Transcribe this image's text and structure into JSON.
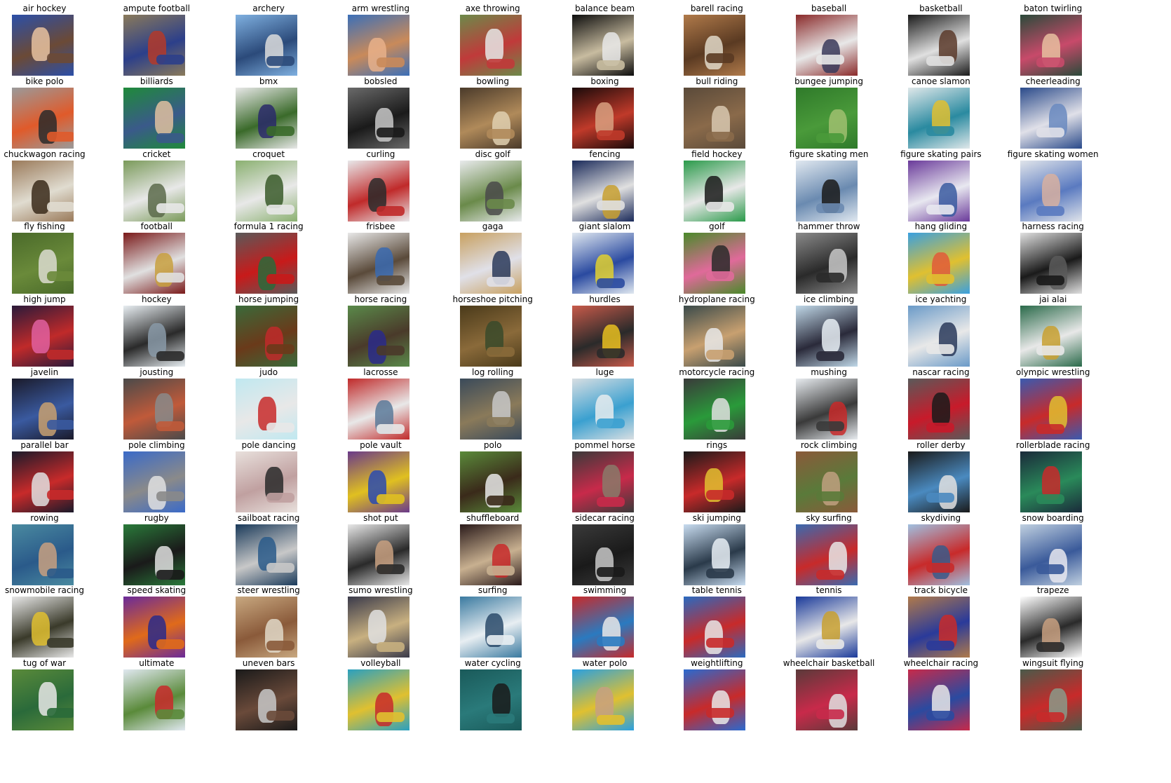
{
  "figure": {
    "rows": 11,
    "cols": 10,
    "tiles": [
      {
        "label": "air hockey",
        "colors": [
          "#2b4fa8",
          "#6b4a36",
          "#e8c2a0"
        ]
      },
      {
        "label": "ampute football",
        "colors": [
          "#8a7a5a",
          "#2c3f8a",
          "#b33a2a"
        ]
      },
      {
        "label": "archery",
        "colors": [
          "#7fb0e0",
          "#2b4a7a",
          "#dcdcdc"
        ]
      },
      {
        "label": "arm wrestling",
        "colors": [
          "#3b6fb8",
          "#c98a5a",
          "#e8b08a"
        ]
      },
      {
        "label": "axe throwing",
        "colors": [
          "#6c8a4a",
          "#c03a3a",
          "#e6e6e6"
        ]
      },
      {
        "label": "balance beam",
        "colors": [
          "#0d0d0d",
          "#c8bca0",
          "#e8e8e8"
        ]
      },
      {
        "label": "barell racing",
        "colors": [
          "#b07a4a",
          "#5a3a22",
          "#e0d8c8"
        ]
      },
      {
        "label": "baseball",
        "colors": [
          "#8a2a2a",
          "#e8e8e8",
          "#3a3a5a"
        ]
      },
      {
        "label": "basketball",
        "colors": [
          "#1a1a1a",
          "#e0e0e0",
          "#5a3a2a"
        ]
      },
      {
        "label": "baton twirling",
        "colors": [
          "#2a4a3a",
          "#c84a6a",
          "#e8c0a0"
        ]
      },
      {
        "label": "bike polo",
        "colors": [
          "#9a9a9a",
          "#e05a2a",
          "#2a2a2a"
        ]
      },
      {
        "label": "billiards",
        "colors": [
          "#1f8a3a",
          "#3a5a8a",
          "#e0c0a0"
        ]
      },
      {
        "label": "bmx",
        "colors": [
          "#e8e8e8",
          "#3a6a2a",
          "#2a2a6a"
        ]
      },
      {
        "label": "bobsled",
        "colors": [
          "#6a6a6a",
          "#1a1a1a",
          "#c8c8c8"
        ]
      },
      {
        "label": "bowling",
        "colors": [
          "#4a3a2a",
          "#b08a5a",
          "#e0d0b0"
        ]
      },
      {
        "label": "boxing",
        "colors": [
          "#1a0a0a",
          "#c03a2a",
          "#d8a080"
        ]
      },
      {
        "label": "bull riding",
        "colors": [
          "#5a4a3a",
          "#8a6a4a",
          "#d8c8b0"
        ]
      },
      {
        "label": "bungee jumping",
        "colors": [
          "#2f7a2a",
          "#4a9a3a",
          "#a0c070"
        ]
      },
      {
        "label": "canoe slamon",
        "colors": [
          "#e0e8ea",
          "#2a8aa0",
          "#e0c030"
        ]
      },
      {
        "label": "cheerleading",
        "colors": [
          "#2a4a8a",
          "#e0e0e8",
          "#6a8ac0"
        ]
      },
      {
        "label": "chuckwagon racing",
        "colors": [
          "#9a7a5a",
          "#e0dcd0",
          "#3a2a1a"
        ]
      },
      {
        "label": "cricket",
        "colors": [
          "#7a9a5a",
          "#e8e8e8",
          "#5a6a4a"
        ]
      },
      {
        "label": "croquet",
        "colors": [
          "#8ab070",
          "#e8e8e8",
          "#3a5a2a"
        ]
      },
      {
        "label": "curling",
        "colors": [
          "#e8e8ea",
          "#c02a2a",
          "#2a2a2a"
        ]
      },
      {
        "label": "disc golf",
        "colors": [
          "#e8eaec",
          "#6a8a4a",
          "#4a4a4a"
        ]
      },
      {
        "label": "fencing",
        "colors": [
          "#1a2a5a",
          "#e0e0e0",
          "#c8a030"
        ]
      },
      {
        "label": "field hockey",
        "colors": [
          "#2a9a4a",
          "#e8e8e8",
          "#1a1a1a"
        ]
      },
      {
        "label": "figure skating men",
        "colors": [
          "#e0e8f0",
          "#6a8ab0",
          "#1a1a1a"
        ]
      },
      {
        "label": "figure skating pairs",
        "colors": [
          "#6a3a9a",
          "#e8e8f0",
          "#3a5aa0"
        ]
      },
      {
        "label": "figure skating women",
        "colors": [
          "#e0e4ea",
          "#5a7ac0",
          "#d8b0a0"
        ]
      },
      {
        "label": "fly fishing",
        "colors": [
          "#4a6a2a",
          "#6a8a3a",
          "#dcdcd0"
        ]
      },
      {
        "label": "football",
        "colors": [
          "#7a1a1a",
          "#e0e0e0",
          "#c8a040"
        ]
      },
      {
        "label": "formula 1 racing",
        "colors": [
          "#5a5a5a",
          "#c81a1a",
          "#2a6a3a"
        ]
      },
      {
        "label": "frisbee",
        "colors": [
          "#e8e8e8",
          "#5a4a3a",
          "#3a6ab0"
        ]
      },
      {
        "label": "gaga",
        "colors": [
          "#c8a060",
          "#e0e0e8",
          "#2a3a5a"
        ]
      },
      {
        "label": "giant slalom",
        "colors": [
          "#e0e8f0",
          "#2a4aa0",
          "#e0d030"
        ]
      },
      {
        "label": "golf",
        "colors": [
          "#4a8a2a",
          "#e06a9a",
          "#2a2a2a"
        ]
      },
      {
        "label": "hammer throw",
        "colors": [
          "#8a8a8a",
          "#2a2a2a",
          "#c8c8c8"
        ]
      },
      {
        "label": "hang gliding",
        "colors": [
          "#3aa0e0",
          "#e0c030",
          "#e05a3a"
        ]
      },
      {
        "label": "harness racing",
        "colors": [
          "#e0e0e0",
          "#1a1a1a",
          "#5a5a5a"
        ]
      },
      {
        "label": "high jump",
        "colors": [
          "#2a1a3a",
          "#c02a2a",
          "#e060a0"
        ]
      },
      {
        "label": "hockey",
        "colors": [
          "#e8eef2",
          "#2a2a2a",
          "#8a9aa8"
        ]
      },
      {
        "label": "horse jumping",
        "colors": [
          "#3a6a3a",
          "#6a3a1a",
          "#c02a2a"
        ]
      },
      {
        "label": "horse racing",
        "colors": [
          "#5a8a4a",
          "#4a3a2a",
          "#2a2a8a"
        ]
      },
      {
        "label": "horseshoe pitching",
        "colors": [
          "#4a3a1a",
          "#8a6a3a",
          "#3a4a2a"
        ]
      },
      {
        "label": "hurdles",
        "colors": [
          "#c85a4a",
          "#2a2a2a",
          "#e8c020"
        ]
      },
      {
        "label": "hydroplane racing",
        "colors": [
          "#3a4a4a",
          "#c8a070",
          "#e8e8e8"
        ]
      },
      {
        "label": "ice climbing",
        "colors": [
          "#c0d8e8",
          "#2a2a3a",
          "#e8eef4"
        ]
      },
      {
        "label": "ice yachting",
        "colors": [
          "#6a9ac8",
          "#e8e8e8",
          "#2a3a5a"
        ]
      },
      {
        "label": "jai alai",
        "colors": [
          "#2a6a4a",
          "#e8e8e8",
          "#c8a030"
        ]
      },
      {
        "label": "javelin",
        "colors": [
          "#1a1a2a",
          "#3a5aa0",
          "#c8a070"
        ]
      },
      {
        "label": "jousting",
        "colors": [
          "#4a4a4a",
          "#c05a3a",
          "#8a8a8a"
        ]
      },
      {
        "label": "judo",
        "colors": [
          "#c0e8f0",
          "#e8e8e8",
          "#c82a2a"
        ]
      },
      {
        "label": "lacrosse",
        "colors": [
          "#c02a2a",
          "#e8e8e8",
          "#5a7a9a"
        ]
      },
      {
        "label": "log rolling",
        "colors": [
          "#3a4a5a",
          "#8a7a5a",
          "#c8c8c8"
        ]
      },
      {
        "label": "luge",
        "colors": [
          "#d8dee2",
          "#3aa0d0",
          "#e8ecee"
        ]
      },
      {
        "label": "motorcycle racing",
        "colors": [
          "#3a3a3a",
          "#2a9a3a",
          "#e0e0e0"
        ]
      },
      {
        "label": "mushing",
        "colors": [
          "#e8ecf0",
          "#3a3a3a",
          "#c82a2a"
        ]
      },
      {
        "label": "nascar racing",
        "colors": [
          "#5a5a5a",
          "#c81a2a",
          "#1a1a1a"
        ]
      },
      {
        "label": "olympic wrestling",
        "colors": [
          "#3a5ab0",
          "#c82a2a",
          "#e0c030"
        ]
      },
      {
        "label": "parallel bar",
        "colors": [
          "#1a1a2a",
          "#c82a2a",
          "#e0e0e0"
        ]
      },
      {
        "label": "pole climbing",
        "colors": [
          "#3a6ac8",
          "#8a8a8a",
          "#e0e0e0"
        ]
      },
      {
        "label": "pole dancing",
        "colors": [
          "#e8e0dc",
          "#c0a0a0",
          "#2a2a2a"
        ]
      },
      {
        "label": "pole vault",
        "colors": [
          "#6a3a8a",
          "#e0c020",
          "#2a4ab0"
        ]
      },
      {
        "label": "polo",
        "colors": [
          "#5a8a3a",
          "#3a2a1a",
          "#e8e8e8"
        ]
      },
      {
        "label": "pommel horse",
        "colors": [
          "#3a3a3a",
          "#c82a4a",
          "#8a7a6a"
        ]
      },
      {
        "label": "rings",
        "colors": [
          "#1a1a1a",
          "#c82a2a",
          "#e0c030"
        ]
      },
      {
        "label": "rock climbing",
        "colors": [
          "#8a5a3a",
          "#5a7a3a",
          "#c0a080"
        ]
      },
      {
        "label": "roller derby",
        "colors": [
          "#1a1a1a",
          "#4a8ac0",
          "#e0e0e0"
        ]
      },
      {
        "label": "rollerblade racing",
        "colors": [
          "#1a2a3a",
          "#2a8a5a",
          "#c82a2a"
        ]
      },
      {
        "label": "rowing",
        "colors": [
          "#4a8aa0",
          "#2a5a8a",
          "#c8a080"
        ]
      },
      {
        "label": "rugby",
        "colors": [
          "#2a7a3a",
          "#1a1a1a",
          "#e0e0e0"
        ]
      },
      {
        "label": "sailboat racing",
        "colors": [
          "#1a3a5a",
          "#c8c8c8",
          "#2a5a8a"
        ]
      },
      {
        "label": "shot put",
        "colors": [
          "#e8e8e8",
          "#2a2a2a",
          "#c8a080"
        ]
      },
      {
        "label": "shuffleboard",
        "colors": [
          "#2a1a1a",
          "#c8b090",
          "#c82a2a"
        ]
      },
      {
        "label": "sidecar racing",
        "colors": [
          "#3a3a3a",
          "#1a1a1a",
          "#c8c8c8"
        ]
      },
      {
        "label": "ski jumping",
        "colors": [
          "#c8dcf0",
          "#2a3a4a",
          "#e8eef4"
        ]
      },
      {
        "label": "sky surfing",
        "colors": [
          "#3a6ab0",
          "#c82a2a",
          "#e8e8e8"
        ]
      },
      {
        "label": "skydiving",
        "colors": [
          "#a0c0e0",
          "#c82a2a",
          "#3a5a8a"
        ]
      },
      {
        "label": "snow boarding",
        "colors": [
          "#c0d0e0",
          "#3a5a9a",
          "#e8e8f0"
        ]
      },
      {
        "label": "snowmobile racing",
        "colors": [
          "#e8e8e8",
          "#3a3a2a",
          "#e0c030"
        ]
      },
      {
        "label": "speed skating",
        "colors": [
          "#6a2a9a",
          "#e06a1a",
          "#2a2a8a"
        ]
      },
      {
        "label": "steer wrestling",
        "colors": [
          "#c8a880",
          "#8a5a3a",
          "#e0d8c8"
        ]
      },
      {
        "label": "sumo wrestling",
        "colors": [
          "#3a3a4a",
          "#c8b080",
          "#e0e0e0"
        ]
      },
      {
        "label": "surfing",
        "colors": [
          "#3a7aa0",
          "#e8eef2",
          "#2a4a6a"
        ]
      },
      {
        "label": "swimming",
        "colors": [
          "#c82a2a",
          "#2a7ac0",
          "#e8e8e8"
        ]
      },
      {
        "label": "table tennis",
        "colors": [
          "#2a6ac0",
          "#c82a2a",
          "#e8e8e8"
        ]
      },
      {
        "label": "tennis",
        "colors": [
          "#1a3a9a",
          "#e8e8e8",
          "#c8a030"
        ]
      },
      {
        "label": "track bicycle",
        "colors": [
          "#b07a4a",
          "#2a3a9a",
          "#c82a2a"
        ]
      },
      {
        "label": "trapeze",
        "colors": [
          "#ffffff",
          "#2a2a2a",
          "#c8a080"
        ]
      },
      {
        "label": "tug of war",
        "colors": [
          "#5a8a3a",
          "#2a6a3a",
          "#e8e8e8"
        ]
      },
      {
        "label": "ultimate",
        "colors": [
          "#e0e8f0",
          "#5a8a3a",
          "#c82a2a"
        ]
      },
      {
        "label": "uneven bars",
        "colors": [
          "#1a1a1a",
          "#6a4a3a",
          "#c8c8c8"
        ]
      },
      {
        "label": "volleyball",
        "colors": [
          "#2aa0c0",
          "#e0c030",
          "#c82a2a"
        ]
      },
      {
        "label": "water cycling",
        "colors": [
          "#1a5a5a",
          "#2a7a7a",
          "#1a1a1a"
        ]
      },
      {
        "label": "water polo",
        "colors": [
          "#2aa0e0",
          "#e0c030",
          "#c8a080"
        ]
      },
      {
        "label": "weightlifting",
        "colors": [
          "#2a6ad0",
          "#c82a2a",
          "#e8e8e8"
        ]
      },
      {
        "label": "wheelchair basketball",
        "colors": [
          "#5a3a3a",
          "#c82a4a",
          "#e0e0e0"
        ]
      },
      {
        "label": "wheelchair racing",
        "colors": [
          "#c82a4a",
          "#2a4aa0",
          "#e8e8e8"
        ]
      },
      {
        "label": "wingsuit flying",
        "colors": [
          "#4a5a4a",
          "#c82a2a",
          "#8a9a8a"
        ]
      }
    ]
  }
}
